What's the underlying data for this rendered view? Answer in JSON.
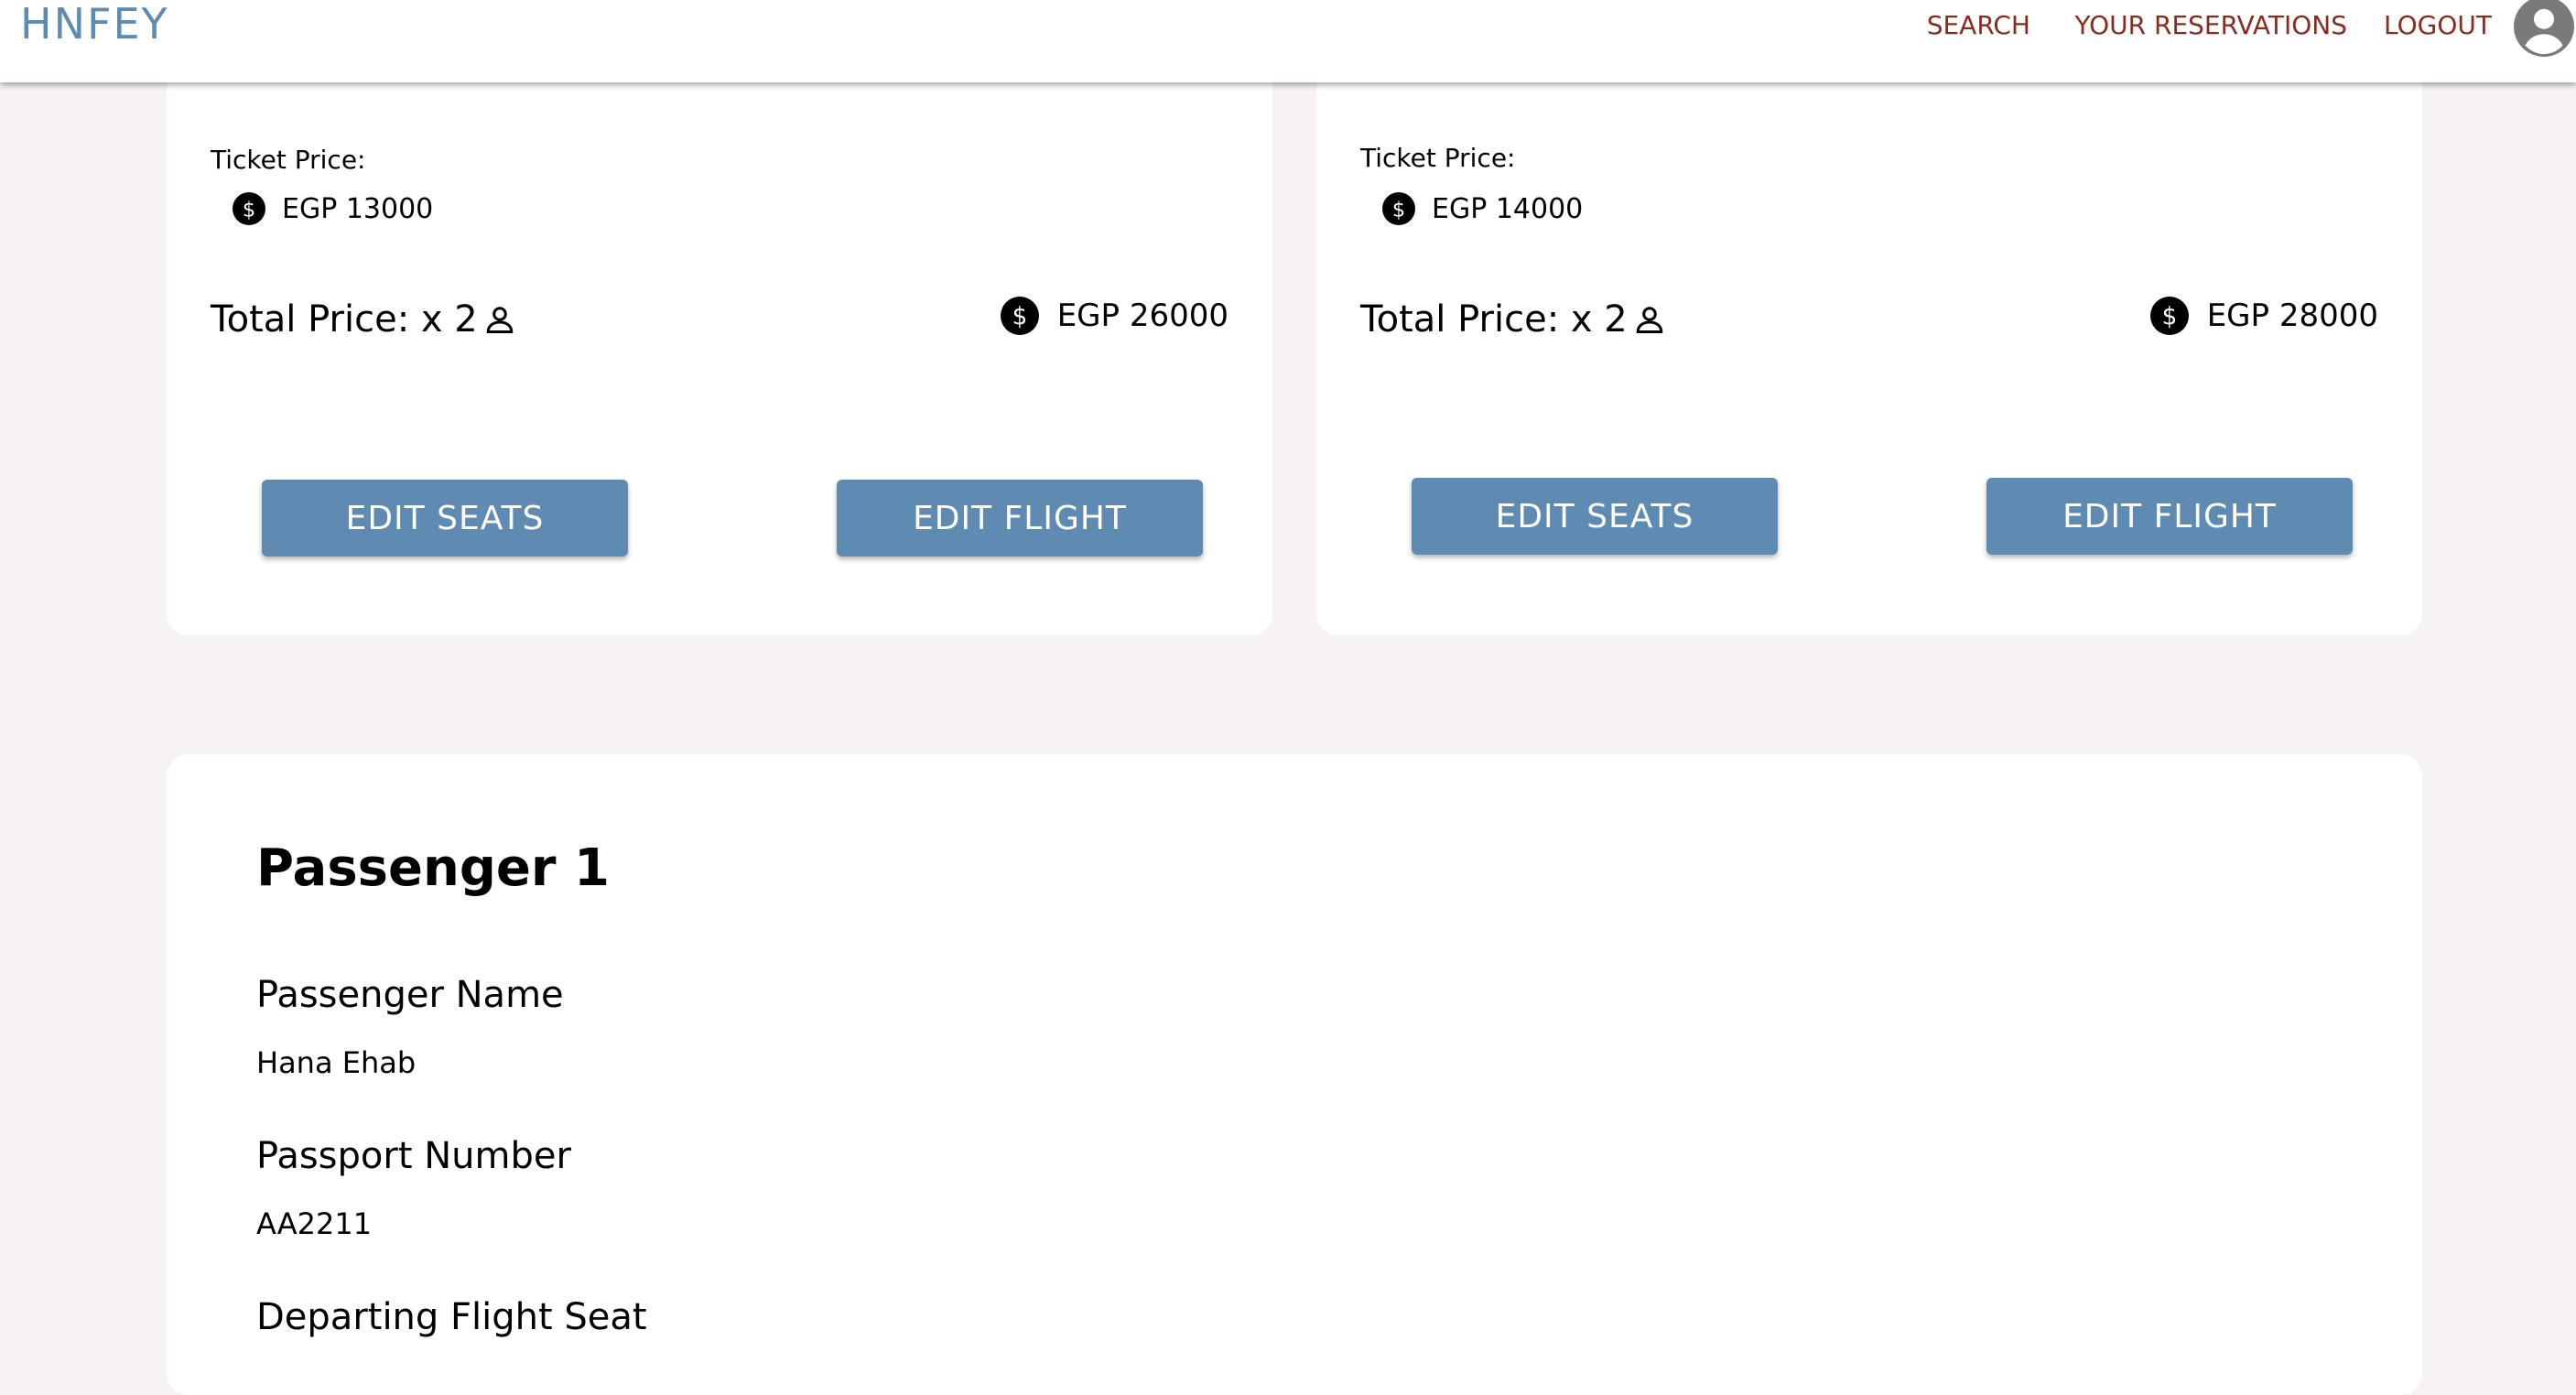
{
  "nav": {
    "brand": "HNFEY",
    "links": {
      "search": "SEARCH",
      "reservations": "YOUR RESERVATIONS",
      "logout": "LOGOUT"
    },
    "avatar_icon": "user-circle-icon"
  },
  "flights": [
    {
      "ticket_price_label": "Ticket Price:",
      "ticket_price": "EGP 13000",
      "total_label": "Total Price: x 2",
      "total_price": "EGP 26000",
      "edit_seats": "EDIT SEATS",
      "edit_flight": "EDIT FLIGHT"
    },
    {
      "ticket_price_label": "Ticket Price:",
      "ticket_price": "EGP 14000",
      "total_label": "Total Price: x 2",
      "total_price": "EGP 28000",
      "edit_seats": "EDIT SEATS",
      "edit_flight": "EDIT FLIGHT"
    }
  ],
  "passenger": {
    "title": "Passenger 1",
    "name_label": "Passenger Name",
    "name_value": "Hana Ehab",
    "passport_label": "Passport Number",
    "passport_value": "AA2211",
    "departing_seat_label": "Departing Flight Seat"
  },
  "colors": {
    "brand": "#5f8ab2",
    "nav_link": "#8a2b1e",
    "button": "#5f8ab2",
    "page_bg": "#f7f3f2"
  }
}
